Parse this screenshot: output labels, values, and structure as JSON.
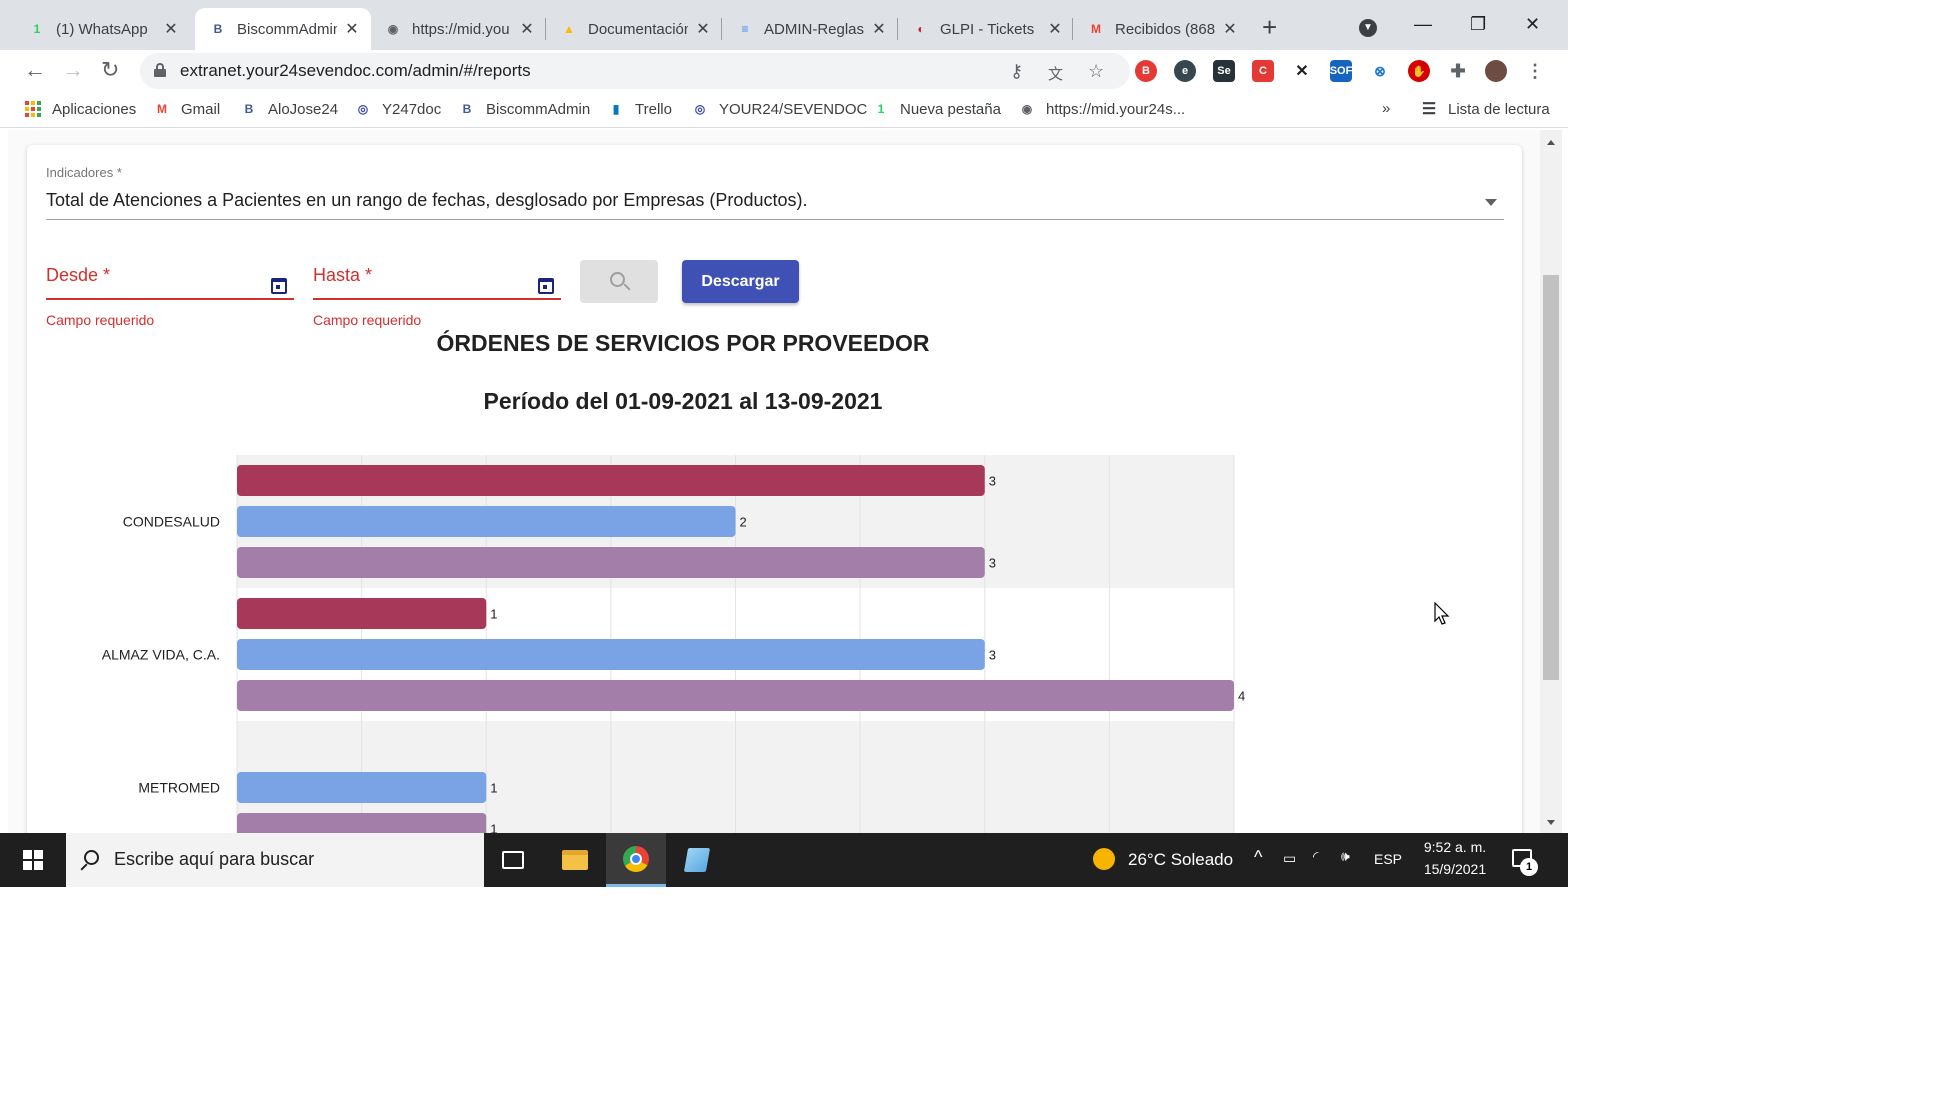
{
  "browser": {
    "tabs": [
      {
        "title": "(1) WhatsApp",
        "icon": "whatsapp-icon",
        "color": "#25d366",
        "glyph": "1"
      },
      {
        "title": "BiscommAdmin",
        "icon": "biscomm-icon",
        "color": "#3f5b8c",
        "glyph": "B"
      },
      {
        "title": "https://mid.you",
        "icon": "globe-icon",
        "color": "#5f6368",
        "glyph": "◉"
      },
      {
        "title": "Documentación",
        "icon": "google-drive-icon",
        "color": "#fbbc04",
        "glyph": "▲"
      },
      {
        "title": "ADMIN-Reglas",
        "icon": "google-docs-icon",
        "color": "#4285f4",
        "glyph": "≡"
      },
      {
        "title": "GLPI - Tickets",
        "icon": "glpi-icon",
        "color": "#c62828",
        "glyph": "◐"
      },
      {
        "title": "Recibidos (868)",
        "icon": "gmail-icon",
        "color": "#ea4335",
        "glyph": "M"
      }
    ],
    "active_tab": 1,
    "url": "extranet.your24sevendoc.com/admin/#/reports",
    "bookmarks": [
      {
        "label": "Aplicaciones",
        "icon": "apps-grid-icon",
        "color": "#ea4335",
        "glyph": ""
      },
      {
        "label": "Gmail",
        "icon": "gmail-icon",
        "color": "#ea4335",
        "glyph": "M"
      },
      {
        "label": "AloJose24",
        "icon": "biscomm-icon",
        "color": "#3f5b8c",
        "glyph": "B"
      },
      {
        "label": "Y247doc",
        "icon": "your24-icon",
        "color": "#3949ab",
        "glyph": "◎"
      },
      {
        "label": "BiscommAdmin",
        "icon": "biscomm-icon",
        "color": "#3f5b8c",
        "glyph": "B"
      },
      {
        "label": "Trello",
        "icon": "trello-icon",
        "color": "#0079bf",
        "glyph": "▮"
      },
      {
        "label": "YOUR24/SEVENDOC",
        "icon": "your24-icon",
        "color": "#3949ab",
        "glyph": "◎"
      },
      {
        "label": "Nueva pestaña",
        "icon": "whatsapp-icon",
        "color": "#25d366",
        "glyph": "1"
      },
      {
        "label": "https://mid.your24s...",
        "icon": "globe-icon",
        "color": "#5f6368",
        "glyph": "◉"
      }
    ],
    "reading_list": "Lista de lectura"
  },
  "form": {
    "indicator_label": "Indicadores *",
    "indicator_value": "Total de Atenciones a Pacientes en un rango de fechas, desglosado por Empresas (Productos).",
    "from_label": "Desde *",
    "to_label": "Hasta *",
    "required_error": "Campo requerido",
    "download_label": "Descargar"
  },
  "chart_data": {
    "type": "bar",
    "orientation": "horizontal",
    "title": "ÓRDENES DE SERVICIOS POR PROVEEDOR",
    "subtitle": "Período del 01-09-2021 al 13-09-2021",
    "categories": [
      "CONDESALUD",
      "ALMAZ VIDA, C.A.",
      "METROMED"
    ],
    "series": [
      {
        "color": "#a8385a",
        "values": [
          3,
          1,
          0
        ]
      },
      {
        "color": "#7aa3e5",
        "values": [
          2,
          3,
          1
        ]
      },
      {
        "color": "#a27ea8",
        "values": [
          3,
          4,
          1
        ]
      }
    ],
    "xlim": [
      0,
      4
    ],
    "grid": true,
    "show_data_labels": true
  },
  "taskbar": {
    "search_placeholder": "Escribe aquí para buscar",
    "weather": "26°C  Soleado",
    "language": "ESP",
    "time": "9:52 a. m.",
    "date": "15/9/2021",
    "notifications": "1"
  }
}
